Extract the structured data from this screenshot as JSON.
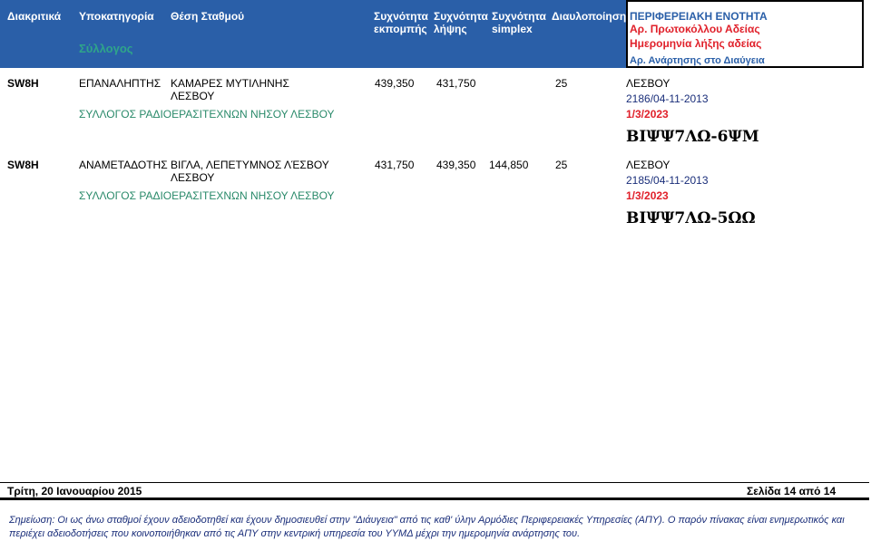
{
  "header": {
    "col_distinctive": "Διακριτικά",
    "col_subcategory": "Υποκατηγορία",
    "col_location": "Θέση Σταθμού",
    "col_tx_freq_1": "Συχνότητα",
    "col_tx_freq_2": "εκπομπής",
    "col_rx_freq_1": "Συχνότητα",
    "col_rx_freq_2": "λήψης",
    "col_simplex_1": "Συχνότητα",
    "col_simplex_2": "simplex",
    "col_tone": "Διαυλοποίηση",
    "col_region": "ΠΕΡΙΦΕΡΕΙΑΚΗ ΕΝΟΤΗΤΑ",
    "col_protocol": "Αρ. Πρωτοκόλλου Αδείας",
    "col_expiry": "Ημερομηνία λήξης αδείας",
    "col_association": "Σύλλογος",
    "col_diavgeia": "Αρ. Ανάρτησης στο Διαύγεια"
  },
  "rows": [
    {
      "callsign": "SW8H",
      "subcategory": "ΕΠΑΝΑΛΗΠΤΗΣ",
      "location_1": "ΚΑΜΑΡΕΣ ΜΥΤΙΛΗΝΗΣ",
      "location_2": "ΛΕΣΒΟΥ",
      "tx_freq": "439,350",
      "rx_freq": "431,750",
      "simplex": "",
      "tone": "25",
      "region": "ΛΕΣΒΟΥ",
      "protocol": "2186/04-11-2013",
      "association": "ΣΥΛΛΟΓΟΣ ΡΑΔΙΟΕΡΑΣΙΤΕΧΝΩΝ ΝΗΣΟΥ ΛΕΣΒΟΥ",
      "expiry": "1/3/2023",
      "diavgeia": "ΒΙΨΨ7ΛΩ-6ΨΜ"
    },
    {
      "callsign": "SW8H",
      "subcategory": "ΑΝΑΜΕΤΑΔΟΤΗΣ",
      "location_1": "ΒΙΓΛΑ, ΛΕΠΕΤΥΜΝΟΣ ΛΈΣΒΟΥ",
      "location_2": "ΛΕΣΒΟΥ",
      "tx_freq": "431,750",
      "rx_freq": "439,350",
      "simplex": "144,850",
      "tone": "25",
      "region": "ΛΕΣΒΟΥ",
      "protocol": "2185/04-11-2013",
      "association": "ΣΥΛΛΟΓΟΣ ΡΑΔΙΟΕΡΑΣΙΤΕΧΝΩΝ ΝΗΣΟΥ ΛΕΣΒΟΥ",
      "expiry": "1/3/2023",
      "diavgeia": "ΒΙΨΨ7ΛΩ-5ΩΩ"
    }
  ],
  "footer": {
    "date": "Τρίτη, 20 Ιανουαρίου 2015",
    "page": "Σελίδα 14 από 14",
    "note": "Σημείωση: Οι ως άνω σταθμοί έχουν αδειοδοτηθεί και έχουν δημοσιευθεί στην \"Διάυγεια\"  από τις καθ' ύλην Αρμόδιες Περιφερειακές Υπηρεσίες (ΑΠΥ). Ο παρόν πίνακας είναι ενημερωτικός και περιέχει αδειοδοτήσεις που κοινοποιήθηκαν από τις  ΑΠΥ στην κεντρική υπηρεσία του ΥΥΜΔ  μέχρι την ημερομηνία ανάρτησης του."
  },
  "colors": {
    "header_band": "#2a5fa8",
    "header_red": "#e0202a",
    "header_green": "#2fa58a",
    "association_green": "#2a8a6a",
    "protocol_navy": "#1a2e7a"
  }
}
